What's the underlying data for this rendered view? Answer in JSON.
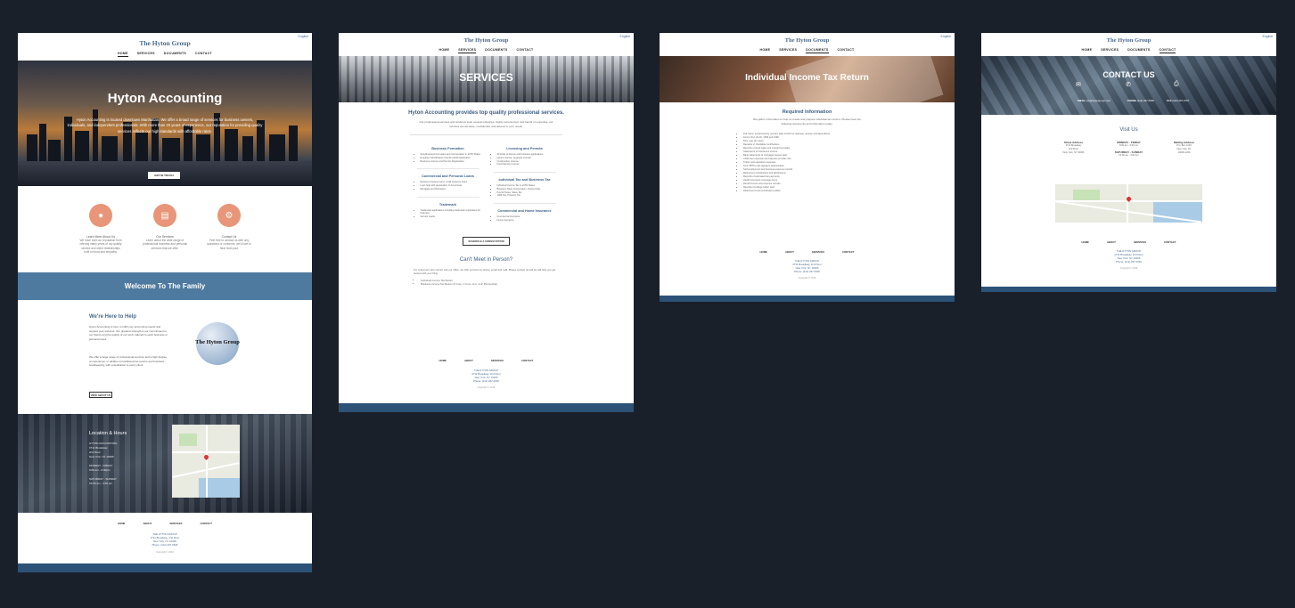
{
  "site": {
    "brand": "The Hyton Group",
    "languages": "English",
    "nav": [
      "HOME",
      "SERVICES",
      "DOCUMENTS",
      "CONTACT"
    ],
    "footer_nav": [
      "HOME",
      "ABOUT",
      "SERVICES",
      "CONTACT"
    ],
    "footer_name": "THE HYTON GROUP",
    "footer_lines": [
      "3711 Broadway, 2nd Floor",
      "New York, NY 10006",
      "Phone: (212) 267-0606"
    ],
    "copyright": "Copyright © 2018"
  },
  "home": {
    "hero_title": "Hyton Accounting",
    "hero_text": "Hyton Accounting is located downtown Manhattan. We offer a broad range of services for business owners, individuals, and independent professionals. With more than 20 years of experience, our reputation for providing quality services reflects our high standards with affordable rates.",
    "hero_button": "GET IN TOUCH",
    "features": [
      {
        "icon": "person-icon",
        "title": "Learn More About Us",
        "text": "We have built our reputation from offering many years of top quality service and client relationships built on trust and empathy."
      },
      {
        "icon": "chart-icon",
        "title": "Our Services",
        "text": "Learn about the wide range of professional business and personal services that we offer."
      },
      {
        "icon": "gear-icon",
        "title": "Contact Us",
        "text": "Feel free to contact us with any questions or concerns, we'd love to hear from you!"
      }
    ],
    "welcome": "Welcome To The Family",
    "help_title": "We're Here to Help",
    "help_p1": "Hyton Accounting is here to fulfill your accounting needs and support your success. Our greatest strength is our commitment to our clients and the quality of our work, tailored to each business or personal need.",
    "help_p2": "We offer a large range of professional services and a high degree of experience, in addition to traditional tax returns and business bookkeeping, with a dedication to every client.",
    "logo_text": "The Hyton Group",
    "help_button": "VIEW ABOUT US",
    "location_title": "Location & Hours",
    "location_lines": [
      "HYTON ACCOUNTING",
      "3711 Broadway",
      "2nd Floor",
      "New York, NY 10006",
      "",
      "MONDAY - FRIDAY",
      "9:00 am - 6:00pm",
      "",
      "SATURDAY - SUNDAY",
      "10:00 am - 4:00 pm"
    ]
  },
  "services": {
    "banner": "SERVICES",
    "title": "Hyton Accounting provides top quality professional services.",
    "intro": "Our professional services and solutions span several industries. Highly experienced, and hands on expertise, our services are accurate, confidential, and tailored to your needs.",
    "columns": [
      [
        {
          "title": "Business Formation",
          "items": [
            "New Business Formation and Incorporation in all 50 States",
            "Employer Identification Number (EIN) Application",
            "Business License and Permits Registration"
          ]
        },
        {
          "title": "Commercial and Personal Loans",
          "items": [
            "Existing company loans, small business loans",
            "Loan help with preparation of documents",
            "Mortgage and Refinance"
          ]
        },
        {
          "title": "Trademark",
          "items": [
            "Trademark applications including trademark registration for business",
            "Service marks"
          ]
        }
      ],
      [
        {
          "title": "Licensing and Permits",
          "items": [
            "All kinds of license and business applications",
            "Liquor License, Cigarette License",
            "Construction License",
            "Food Service License"
          ]
        },
        {
          "title": "Individual Tax and Business Tax",
          "items": [
            "Individual Income Tax in all 50 States",
            "Business Taxes (Corporation, Partnership)",
            "Payroll Taxes, Sales Tax",
            "1099 Tax, Property Tax"
          ]
        },
        {
          "title": "Commercial and Home Insurance",
          "items": [
            "Commercial Insurance",
            "Home Insurance"
          ]
        }
      ]
    ],
    "button": "SCHEDULE A CONSULTATION",
    "person_title": "Can't Meet in Person?",
    "person_text": "For customers who cannot visit our office, we offer services by phone, email and mail. Please contact us and we will help you get started with your filing.",
    "person_items": [
      "Individual Income Tax Return",
      "Business Income Tax Return (S Corp, C Corp, LLC, LLP, Partnership)"
    ]
  },
  "tax": {
    "banner": "Individual Income Tax Return",
    "title": "Required Information",
    "intro": "We gather information to help us create and prepare individual tax returns. Please have the following documents and information ready.",
    "items": [
      "Full name, social security number, date of birth for taxpayer, spouse and dependents",
      "Forms W-2, W-2G, 1099 and 1098",
      "Prior year tax return",
      "Receipts of charitable contributions",
      "Records of stock sales and mutual fund sales",
      "Statements of investment income",
      "Bank statements of mortgage interest paid",
      "Child care expenses and daycare provider info",
      "Tuition and education expenses",
      "Form 8879 e-file signature authorization",
      "Self employment and business expense records",
      "Retirement contributions and distributions",
      "Records of estimated tax payments",
      "Health insurance coverage forms",
      "Rental income and expense records",
      "Records of college tuition paid",
      "Retirement Fund contributions (IRA)"
    ]
  },
  "contact": {
    "banner": "CONTACT US",
    "email_label": "EMAIL",
    "email": "info@hytongroup.com",
    "phone_label": "PHONE",
    "phone": "(212) 267-0606",
    "fax_label": "FAX",
    "fax": "(212) 267-0707",
    "visit_title": "Visit Us",
    "cols": [
      {
        "title": "Street Address",
        "lines": [
          "3711 Broadway",
          "2nd Floor",
          "New York, NY 10006"
        ]
      },
      {
        "title": "MONDAY - FRIDAY",
        "lines": [
          "9:00 am - 6:00 pm",
          "",
          "SATURDAY - SUNDAY",
          "10:00 am - 4:00 pm"
        ]
      },
      {
        "title": "Mailing Address",
        "lines": [
          "P.O. Box 1234",
          "New York, NY",
          "10006-1234"
        ]
      }
    ]
  },
  "colors": {
    "accent": "#4e7aa0",
    "footer_bar": "#2c5277",
    "feature_icon": "#e8957a"
  }
}
